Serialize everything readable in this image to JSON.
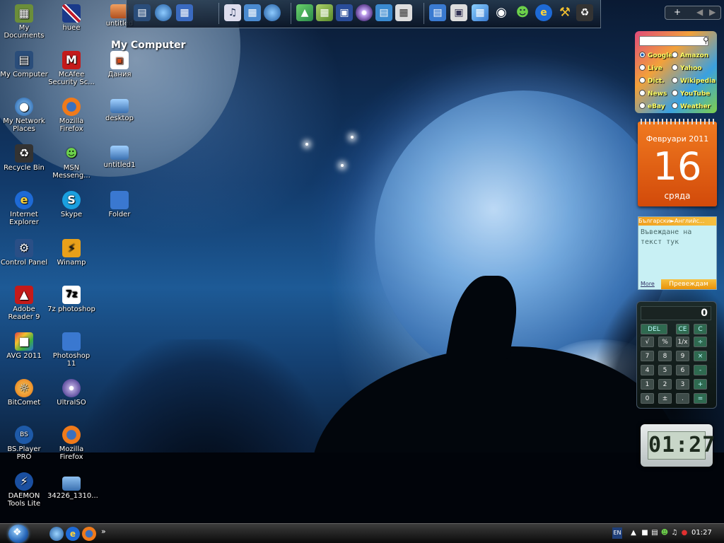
{
  "desktop": {
    "icons": [
      {
        "label": "My Documents",
        "icon": "documents-icon"
      },
      {
        "label": "My Computer",
        "icon": "computer-icon"
      },
      {
        "label": "My Network Places",
        "icon": "network-icon"
      },
      {
        "label": "Recycle Bin",
        "icon": "recycle-bin-icon"
      },
      {
        "label": "Internet Explorer",
        "icon": "internet-explorer-icon"
      },
      {
        "label": "Control Panel",
        "icon": "control-panel-icon"
      },
      {
        "label": "Adobe Reader 9",
        "icon": "adobe-reader-icon"
      },
      {
        "label": "AVG 2011",
        "icon": "avg-icon"
      },
      {
        "label": "BitComet",
        "icon": "bitcomet-icon"
      },
      {
        "label": "BS.Player PRO",
        "icon": "bsplayer-icon"
      },
      {
        "label": "DAEMON Tools Lite",
        "icon": "daemon-tools-icon"
      },
      {
        "label": "huee",
        "icon": "uk-flag-icon"
      },
      {
        "label": "McAfee Security Sc...",
        "icon": "mcafee-icon"
      },
      {
        "label": "Mozilla Firefox",
        "icon": "firefox-icon"
      },
      {
        "label": "MSN Messeng...",
        "icon": "msn-messenger-icon"
      },
      {
        "label": "Skype",
        "icon": "skype-icon"
      },
      {
        "label": "Winamp",
        "icon": "winamp-icon"
      },
      {
        "label": "7z photoshop",
        "icon": "7z-archive-icon"
      },
      {
        "label": "Photoshop 11",
        "icon": "folder-icon"
      },
      {
        "label": "UltraISO",
        "icon": "ultraiso-icon"
      },
      {
        "label": "Mozilla Firefox",
        "icon": "firefox-icon"
      },
      {
        "label": "34226_1310...",
        "icon": "image-file-icon"
      },
      {
        "label": "untitled",
        "icon": "image-file-icon"
      },
      {
        "label": "Дания",
        "icon": "powerpoint-file-icon"
      },
      {
        "label": "desktop",
        "icon": "image-file-icon"
      },
      {
        "label": "untitled1",
        "icon": "image-file-icon"
      },
      {
        "label": "Folder",
        "icon": "folder-icon"
      }
    ]
  },
  "dock": {
    "title": "My Computer"
  },
  "search_gadget": {
    "options": [
      "Google",
      "Amazon",
      "Live",
      "Yahoo",
      "Dict.",
      "Wikipedia",
      "News",
      "YouTube",
      "eBay",
      "Weather"
    ],
    "selected": "Google"
  },
  "calendar": {
    "month": "Февруари 2011",
    "day": "16",
    "weekday": "сряда"
  },
  "translator": {
    "header": "Български►Английс...",
    "input_text": "Въвеждане на текст тук",
    "more_label": "More",
    "button_label": "Превеждам"
  },
  "calculator": {
    "display": "0",
    "keys": [
      "DEL",
      "CE",
      "C",
      "√",
      "%",
      "1/x",
      "÷",
      "7",
      "8",
      "9",
      "×",
      "4",
      "5",
      "6",
      "-",
      "1",
      "2",
      "3",
      "+",
      "0",
      "±",
      ".",
      "="
    ]
  },
  "desktop_clock": {
    "time": "01:27"
  },
  "taskbar": {
    "language": "EN",
    "time": "01:27",
    "more_label": "»"
  },
  "colors": {
    "accent": "#1d5a96",
    "calendar": "#e0601a",
    "search_option_text": "#ffff66"
  }
}
